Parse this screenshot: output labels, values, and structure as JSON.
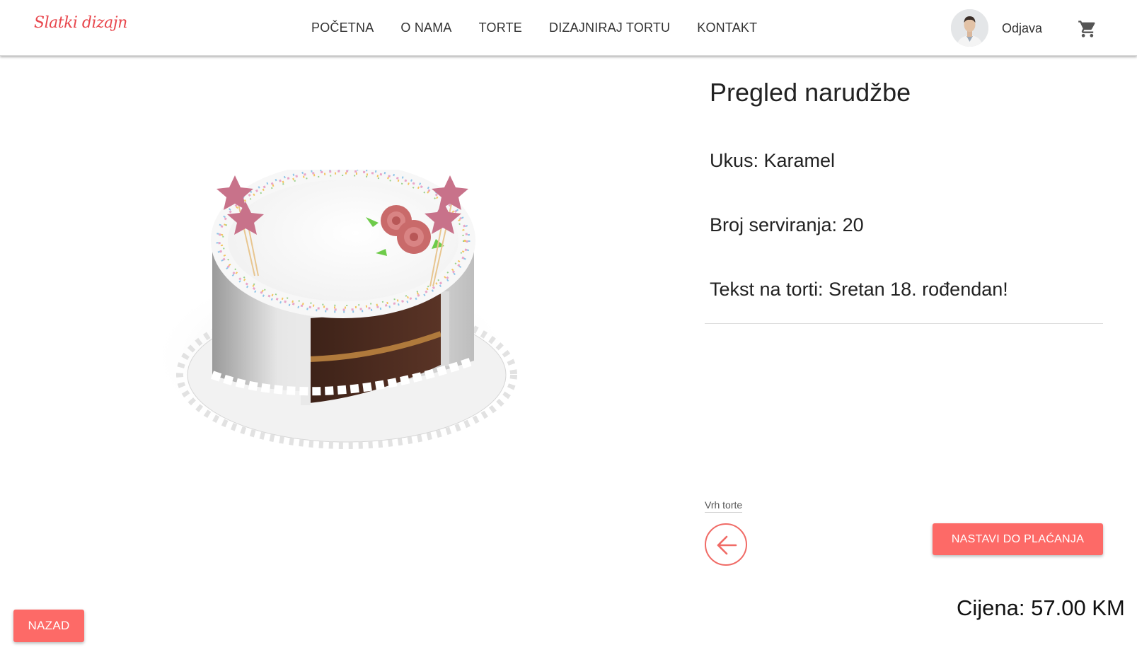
{
  "header": {
    "logo_text": "Slatki dizajn",
    "nav": [
      {
        "label": "POČETNA"
      },
      {
        "label": "O NAMA"
      },
      {
        "label": "TORTE"
      },
      {
        "label": "DIZAJNIRAJ TORTU"
      },
      {
        "label": "KONTAKT"
      }
    ],
    "logout_label": "Odjava",
    "cart_icon": "shopping-cart-icon"
  },
  "summary": {
    "title": "Pregled narudžbe",
    "flavor": "Ukus: Karamel",
    "servings": "Broj serviranja: 20",
    "cake_text": "Tekst na torti: Sretan 18. rođendan!"
  },
  "viewer": {
    "view_label": "Vrh torte",
    "prev_icon": "arrow-left-icon"
  },
  "actions": {
    "checkout_label": "NASTAVI DO PLAĆANJA",
    "back_label": "NAZAD"
  },
  "price": {
    "text": "Cijena: 57.00 KM"
  },
  "colors": {
    "accent": "#fd6a67",
    "logo": "#e8474d"
  }
}
